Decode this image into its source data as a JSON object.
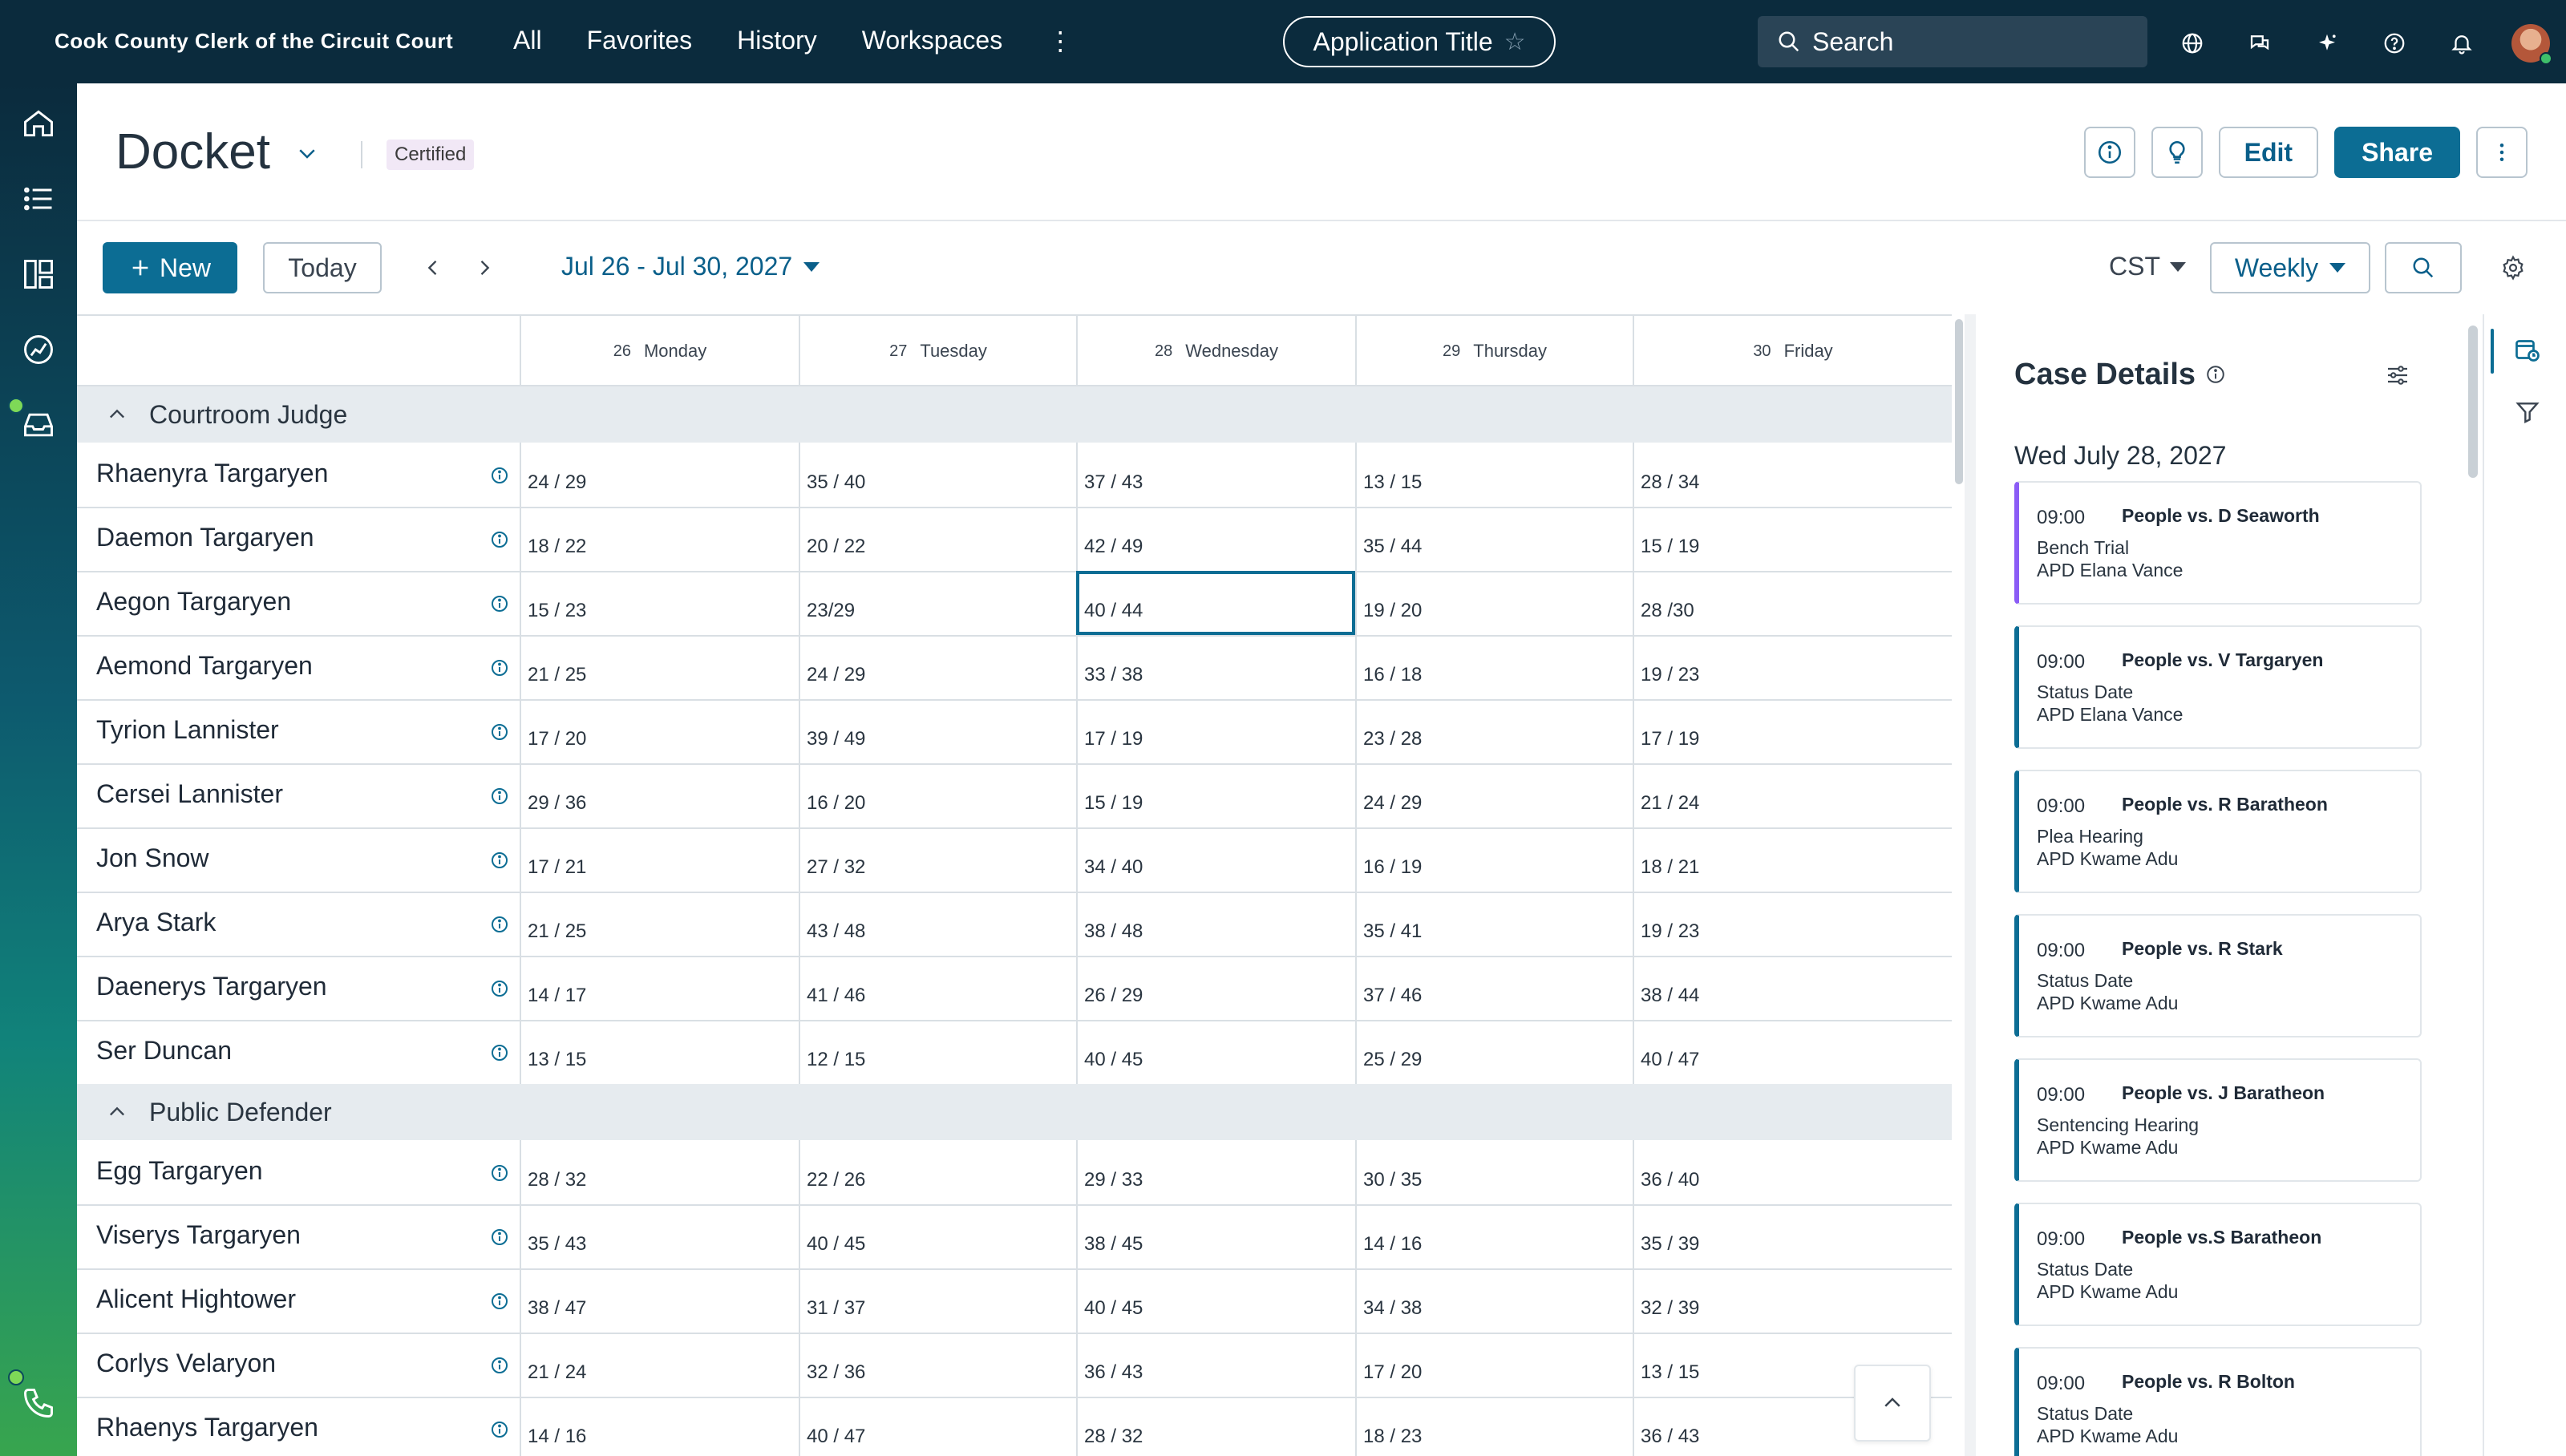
{
  "topbar": {
    "brand": "Cook County Clerk of the Circuit Court",
    "nav": [
      "All",
      "Favorites",
      "History",
      "Workspaces"
    ],
    "app_title": "Application Title",
    "search_placeholder": "Search",
    "icons": [
      "globe-icon",
      "chat-icon",
      "sparkle-icon",
      "help-icon",
      "bell-icon",
      "avatar"
    ]
  },
  "rail": {
    "items": [
      "home-icon",
      "list-icon",
      "dashboard-icon",
      "analytics-icon",
      "inbox-icon",
      "phone-icon"
    ]
  },
  "header": {
    "title": "Docket",
    "badge": "Certified",
    "edit_label": "Edit",
    "share_label": "Share"
  },
  "toolbar": {
    "new_label": "New",
    "today_label": "Today",
    "date_range": "Jul 26 - Jul 30, 2027",
    "timezone": "CST",
    "view": "Weekly"
  },
  "grid": {
    "days": [
      {
        "num": "26",
        "label": "Monday"
      },
      {
        "num": "27",
        "label": "Tuesday"
      },
      {
        "num": "28",
        "label": "Wednesday"
      },
      {
        "num": "29",
        "label": "Thursday"
      },
      {
        "num": "30",
        "label": "Friday"
      }
    ],
    "groups": [
      {
        "label": "Courtroom Judge",
        "rows": [
          {
            "name": "Rhaenyra Targaryen",
            "values": [
              "24 / 29",
              "35 / 40",
              "37 / 43",
              "13 / 15",
              "28 / 34"
            ]
          },
          {
            "name": "Daemon Targaryen",
            "values": [
              "18 / 22",
              "20 / 22",
              "42 / 49",
              "35 / 44",
              "15 / 19"
            ]
          },
          {
            "name": "Aegon Targaryen",
            "values": [
              "15 / 23",
              "23/29",
              "40 / 44",
              "19 / 20",
              "28 /30"
            ]
          },
          {
            "name": "Aemond Targaryen",
            "values": [
              "21 / 25",
              "24 / 29",
              "33 / 38",
              "16 / 18",
              "19 / 23"
            ]
          },
          {
            "name": "Tyrion Lannister",
            "values": [
              "17 / 20",
              "39 / 49",
              "17 / 19",
              "23 / 28",
              "17 / 19"
            ]
          },
          {
            "name": "Cersei Lannister",
            "values": [
              "29 / 36",
              "16 / 20",
              "15 / 19",
              "24 / 29",
              "21 / 24"
            ]
          },
          {
            "name": "Jon Snow",
            "values": [
              "17 / 21",
              "27 / 32",
              "34 / 40",
              "16 / 19",
              "18 / 21"
            ]
          },
          {
            "name": "Arya Stark",
            "values": [
              "21 / 25",
              "43 / 48",
              "38 / 48",
              "35 / 41",
              "19 / 23"
            ]
          },
          {
            "name": "Daenerys Targaryen",
            "values": [
              "14 / 17",
              "41 / 46",
              "26 / 29",
              "37 / 46",
              "38 / 44"
            ]
          },
          {
            "name": "Ser Duncan",
            "values": [
              "13 / 15",
              "12 / 15",
              "40 / 45",
              "25 / 29",
              "40 / 47"
            ]
          }
        ]
      },
      {
        "label": "Public Defender",
        "rows": [
          {
            "name": "Egg Targaryen",
            "values": [
              "28 / 32",
              "22 / 26",
              "29 / 33",
              "30 / 35",
              "36 / 40"
            ]
          },
          {
            "name": "Viserys Targaryen",
            "values": [
              "35 / 43",
              "40 / 45",
              "38 / 45",
              "14 / 16",
              "35 / 39"
            ]
          },
          {
            "name": "Alicent Hightower",
            "values": [
              "38 / 47",
              "31 / 37",
              "40 / 45",
              "34 / 38",
              "32 / 39"
            ]
          },
          {
            "name": "Corlys Velaryon",
            "values": [
              "21 / 24",
              "32 / 36",
              "36 / 43",
              "17 / 20",
              "13 / 15"
            ]
          },
          {
            "name": "Rhaenys Targaryen",
            "values": [
              "14 / 16",
              "40 / 47",
              "28 / 32",
              "18 / 23",
              "36 / 43"
            ]
          }
        ]
      }
    ]
  },
  "panel": {
    "title": "Case Details",
    "date": "Wed July 28, 2027",
    "cards": [
      {
        "time": "09:00",
        "case": "People vs. D Seaworth",
        "type": "Bench Trial",
        "apd": "APD Elana Vance"
      },
      {
        "time": "09:00",
        "case": "People vs. V Targaryen",
        "type": "Status Date",
        "apd": "APD Elana Vance"
      },
      {
        "time": "09:00",
        "case": "People vs. R Baratheon",
        "type": "Plea Hearing",
        "apd": "APD Kwame Adu"
      },
      {
        "time": "09:00",
        "case": "People vs. R Stark",
        "type": "Status Date",
        "apd": "APD Kwame Adu"
      },
      {
        "time": "09:00",
        "case": "People vs. J Baratheon",
        "type": "Sentencing Hearing",
        "apd": "APD Kwame Adu"
      },
      {
        "time": "09:00",
        "case": "People vs.S Baratheon",
        "type": "Status Date",
        "apd": "APD Kwame Adu"
      },
      {
        "time": "09:00",
        "case": "People vs. R Bolton",
        "type": "Status Date",
        "apd": "APD Kwame Adu"
      }
    ]
  },
  "colors": {
    "brand_dark": "#0b2b3d",
    "primary": "#0c6d94",
    "link": "#0a5f8a",
    "row_border": "#d9dfe4",
    "group_bg": "#e6ebef",
    "purple_accent": "#8b5cf6"
  }
}
